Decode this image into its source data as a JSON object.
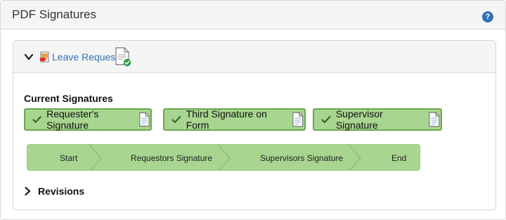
{
  "header": {
    "title": "PDF Signatures",
    "help_icon": "question-circle-icon",
    "help_glyph": "?"
  },
  "document": {
    "name": "Leave Request",
    "expanded": true,
    "file_icon": "pdf-file-icon",
    "status_icon": "signed-document-icon"
  },
  "current_signatures": {
    "title": "Current Signatures",
    "items": [
      {
        "label": "Requester's Signature",
        "status": "signed"
      },
      {
        "label": "Third Signature on Form",
        "status": "signed"
      },
      {
        "label": "Supervisor Signature",
        "status": "signed"
      }
    ]
  },
  "workflow": {
    "steps": [
      "Start",
      "Requestors Signature",
      "Supervisors Signature",
      "End"
    ]
  },
  "revisions": {
    "label": "Revisions",
    "expanded": false
  },
  "colors": {
    "accent": "#2f72b8",
    "signed_fill": "#a8d58f",
    "signed_border": "#6aa84f",
    "header_bg": "#f5f5f5"
  }
}
